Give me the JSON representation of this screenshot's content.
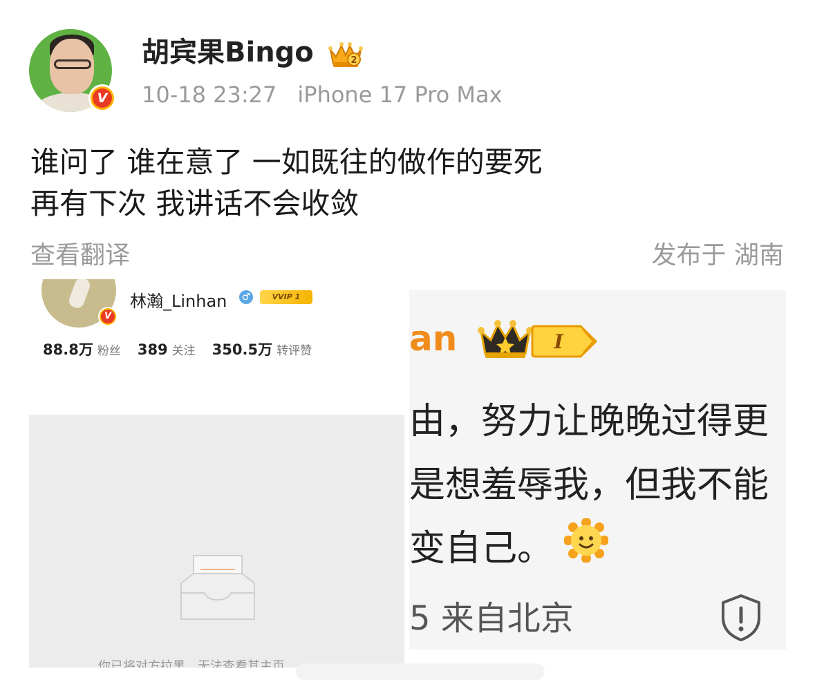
{
  "post": {
    "username": "胡宾果Bingo",
    "time": "10-18 23:27",
    "device": "iPhone 17 Pro Max",
    "text": "谁问了 谁在意了 一如既往的做作的要死\n再有下次 我讲话不会收敛",
    "translate_label": "查看翻译",
    "location": "发布于 湖南",
    "badge_level": "2"
  },
  "left_image": {
    "name": "林瀚_Linhan",
    "vvip_label": "VVIP 1",
    "stats": [
      {
        "value": "88.8万",
        "label": "粉丝"
      },
      {
        "value": "389",
        "label": "关注"
      },
      {
        "value": "350.5万",
        "label": "转评赞"
      }
    ],
    "cut_caption": "你已将对方拉黑，无法查看其主页"
  },
  "right_image": {
    "name_fragment": "an",
    "level_label": "I",
    "lines": "由，努力让晚晚过得更\n是想羞辱我，但我不能\n变自己。",
    "footer": "5 来自北京"
  },
  "colors": {
    "verified_red": "#e93a23",
    "gold": "#ffb400",
    "meta_gray": "#9a9a9a",
    "orange_name": "#f08c1c"
  },
  "icons": [
    "verified-badge-icon",
    "crown-icon",
    "gender-male-icon",
    "vvip-icon",
    "empty-box-icon",
    "sun-emoji-icon",
    "shield-warning-icon"
  ]
}
